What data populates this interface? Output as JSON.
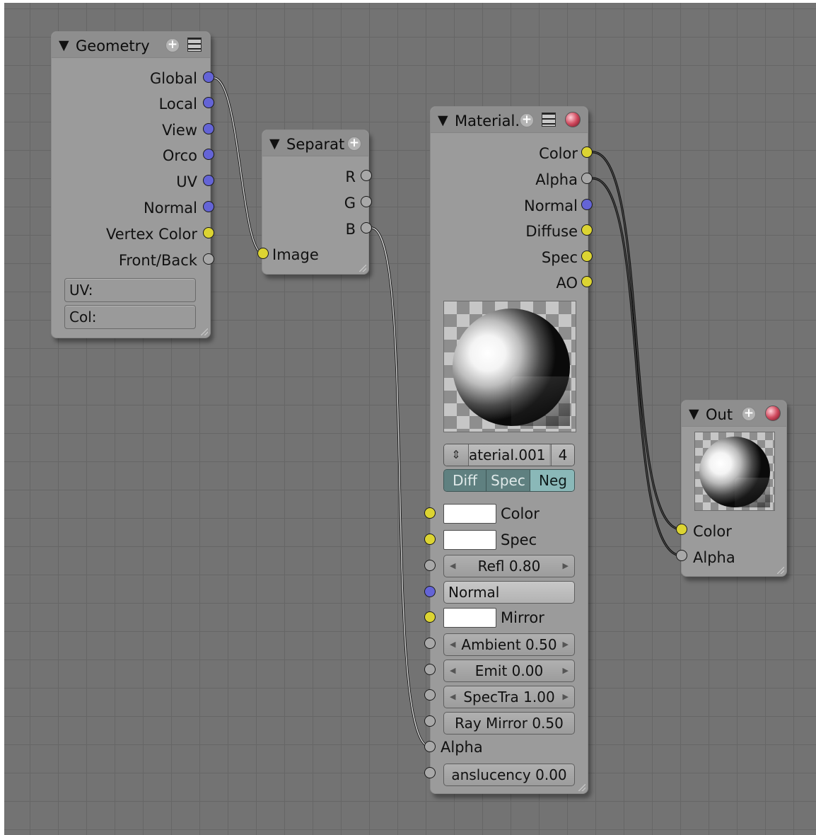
{
  "nodes": {
    "geometry": {
      "title": "Geometry",
      "outputs": [
        "Global",
        "Local",
        "View",
        "Orco",
        "UV",
        "Normal",
        "Vertex Color",
        "Front/Back"
      ],
      "uv_field": "UV:",
      "col_field": "Col:"
    },
    "separate": {
      "title": "Separat",
      "outputs": [
        "R",
        "G",
        "B"
      ],
      "input": "Image"
    },
    "material": {
      "title": "Material.",
      "outputs": [
        "Color",
        "Alpha",
        "Normal",
        "Diffuse",
        "Spec",
        "AO"
      ],
      "material_name": "aterial.001",
      "users": "4",
      "toggles": [
        "Diff",
        "Spec",
        "Neg"
      ],
      "inputs": {
        "color": "Color",
        "spec": "Spec",
        "refl": "Refl 0.80",
        "normal": "Normal",
        "mirror": "Mirror",
        "ambient": "Ambient 0.50",
        "emit": "Emit 0.00",
        "spectra": "SpecTra 1.00",
        "ray_mirror": "Ray Mirror 0.50",
        "alpha": "Alpha",
        "translucency": "anslucency 0.00"
      }
    },
    "output": {
      "title": "Out",
      "inputs": [
        "Color",
        "Alpha"
      ]
    }
  },
  "socket_colors": {
    "color": "#dcd432",
    "vector": "#6464d6",
    "value": "#a8a8a8"
  },
  "icons": [
    "triangle-down-icon",
    "plus-icon",
    "list-icon",
    "material-ball-icon",
    "resize-grip-icon"
  ]
}
